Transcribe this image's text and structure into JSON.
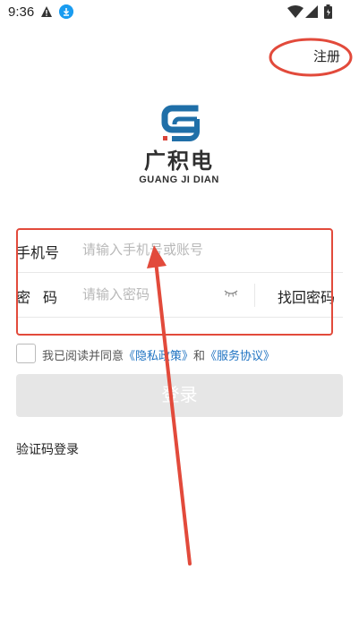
{
  "status_bar": {
    "time": "9:36",
    "icons": [
      "alert-icon",
      "download-icon",
      "wifi-icon",
      "signal-icon",
      "battery-icon"
    ]
  },
  "header": {
    "register_label": "注册"
  },
  "logo": {
    "name_cn": "广积电",
    "name_en": "GUANG JI DIAN"
  },
  "form": {
    "phone_label": "手机号",
    "phone_placeholder": "请输入手机号或账号",
    "password_label": "密码",
    "password_placeholder": "请输入密码",
    "forgot_label": "找回密码"
  },
  "agreement": {
    "prefix": "我已阅读并同意",
    "privacy_link": "《隐私政策》",
    "conjunction": "和",
    "service_link": "《服务协议》"
  },
  "login_button": "登录",
  "sms_login_label": "验证码登录",
  "colors": {
    "annotation_red": "#e24a3b",
    "link_blue": "#1f73c2",
    "logo_blue": "#1f6fa8",
    "logo_red": "#d9443a",
    "button_disabled": "#e6e6e6"
  }
}
